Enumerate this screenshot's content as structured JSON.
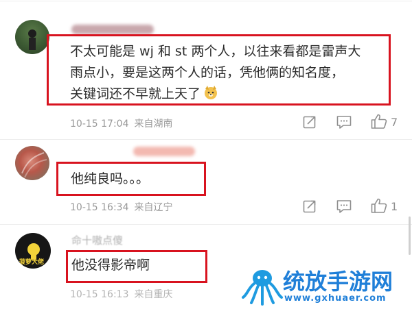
{
  "comments": [
    {
      "text_lines": [
        "不太可能是 wj 和 st 两个人，以往来看都是雷声大",
        "雨点小，要是这两个人的话，凭他俩的知名度，",
        "关键词还不早就上天了"
      ],
      "time": "10-15 17:04",
      "location": "来自湖南",
      "likes": "7"
    },
    {
      "text_lines": [
        "他纯良吗。。。"
      ],
      "time": "10-15 16:34",
      "location": "来自辽宁",
      "likes": "1"
    },
    {
      "text_lines": [
        "他没得影帝啊"
      ],
      "username": "命十嗷点傻",
      "time": "10-15 16:13",
      "location": "来自重庆",
      "avatar_text": "菠萝大佬"
    }
  ],
  "watermark": {
    "title": "统放手游网",
    "url": "www.gxhuaer.com"
  },
  "colors": {
    "highlight": "#d8131f",
    "meta": "#999999",
    "watermark": "#1f7fd8"
  },
  "icons": [
    "repost-icon",
    "comment-icon",
    "like-icon",
    "doge-emoji",
    "octopus-logo"
  ]
}
